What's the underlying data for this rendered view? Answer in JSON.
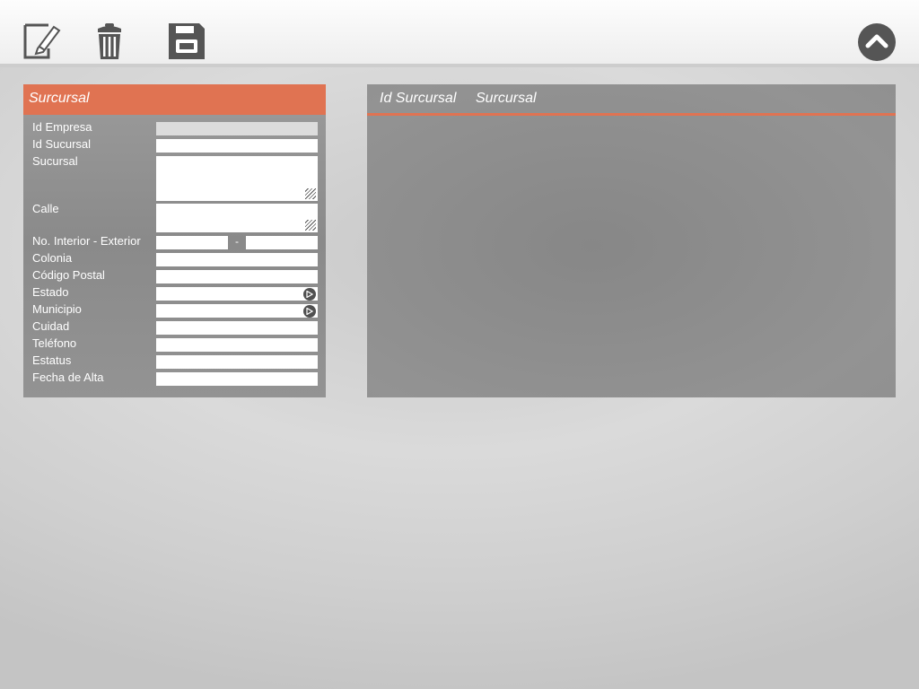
{
  "toolbar": {
    "edit_icon": "edit-icon",
    "delete_icon": "trash-icon",
    "save_icon": "floppy-icon",
    "up_icon": "chevron-up-icon"
  },
  "form": {
    "title": "Surcursal",
    "fields": {
      "id_empresa": {
        "label": "Id Empresa",
        "value": ""
      },
      "id_sucursal": {
        "label": "Id Sucursal",
        "value": ""
      },
      "sucursal": {
        "label": "Sucursal",
        "value": ""
      },
      "calle": {
        "label": "Calle",
        "value": ""
      },
      "no_int_ext": {
        "label": "No. Interior - Exterior",
        "separator": "-",
        "interior": "",
        "exterior": ""
      },
      "colonia": {
        "label": "Colonia",
        "value": ""
      },
      "codigo_postal": {
        "label": "Código Postal",
        "value": ""
      },
      "estado": {
        "label": "Estado",
        "value": ""
      },
      "municipio": {
        "label": "Municipio",
        "value": ""
      },
      "cuidad": {
        "label": "Cuidad",
        "value": ""
      },
      "telefono": {
        "label": "Teléfono",
        "value": ""
      },
      "estatus": {
        "label": "Estatus",
        "value": ""
      },
      "fecha_alta": {
        "label": "Fecha de Alta",
        "value": ""
      }
    }
  },
  "grid": {
    "columns": [
      "Id Surcursal",
      "Surcursal"
    ],
    "rows": []
  },
  "colors": {
    "accent": "#e07352",
    "panel": "#8f8f8f",
    "icon": "#555555"
  }
}
